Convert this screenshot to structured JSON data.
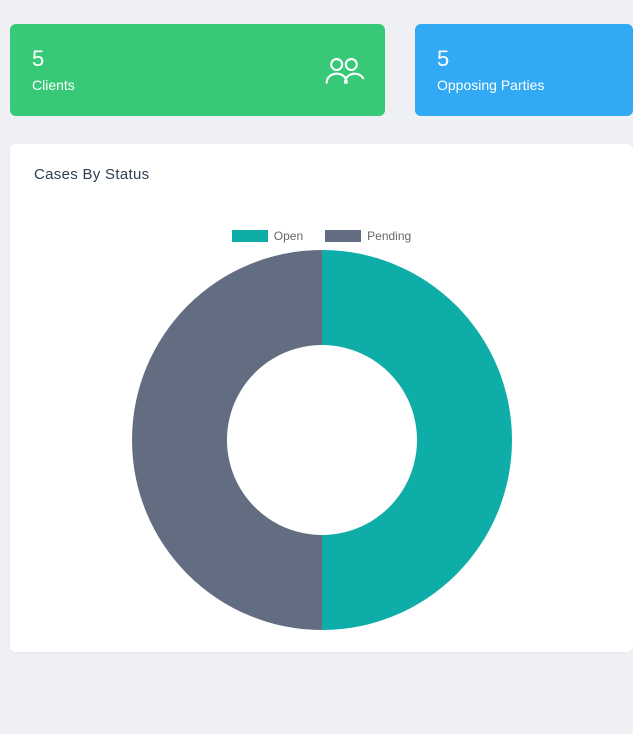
{
  "cards": {
    "clients": {
      "value": "5",
      "label": "Clients",
      "color": "#37c977"
    },
    "opposing": {
      "value": "5",
      "label": "Opposing Parties",
      "color": "#31a9f4"
    }
  },
  "panel": {
    "title": "Cases By Status"
  },
  "chart_data": {
    "type": "pie",
    "title": "Cases By Status",
    "series": [
      {
        "name": "Open",
        "value": 50,
        "color": "#0eada8"
      },
      {
        "name": "Pending",
        "value": 50,
        "color": "#636d82"
      }
    ],
    "donut_inner_ratio": 0.5
  }
}
